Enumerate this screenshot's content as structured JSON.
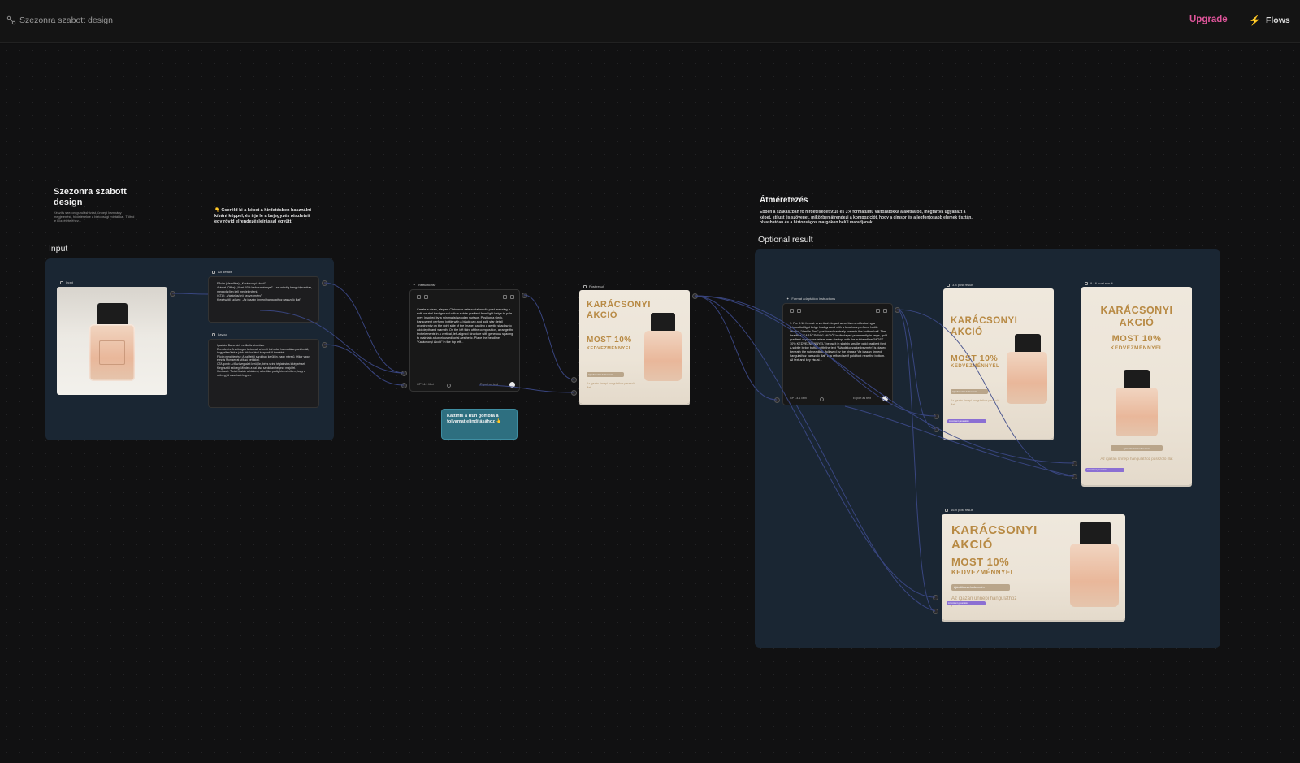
{
  "topbar": {
    "flow_name": "Szezonra szabott design",
    "upgrade_label": "Upgrade",
    "flows_label": "Flows",
    "icons": [
      "flow-icon",
      "bolt-icon"
    ],
    "upgrade_color": "#e0559b"
  },
  "canvas": {
    "title": "Szezonra szabott design",
    "title_desc": "Készíts szezon-guruláshívást, ünnepi kampány megjelenést, hirdetésekre a biztonsági mintákkal. Töltsd le közzétételéhez...",
    "note_left": "👇 Cseréld ki a képet a hirdetésben használni kívánt képpel, és írja le a bejegyzés részleteit egy rövid elrendezésleírással együtt.",
    "input_group_title": "Input",
    "optional_group_title": "Optional result",
    "resize_title": "Átméretezés",
    "resize_desc": "Ebben a szakaszban fő hirdetésedet 9:16 és 3:4 formátumú változatokká alakíthatod, megtartva ugyanazt a képet, stílust és szöveget, miközben átrendezi a kompozíciót, hogy a címsor és a legfontosabb elemek tisztán, olvashatóan és a biztonságos margókon belül maradjanak.",
    "tooltip": "Kattints a Run gombra a folyamat elindításához 👆"
  },
  "nodes": {
    "input_label": "Input",
    "ad_details_label": "Ad details",
    "ad_details_items": [
      "Főcím (Headline): „Karácsonyi Akció!”",
      "Ajánlat (Offer): „Most 10% kedvezménnyel” – azt mindig hangsúlyozottan, meggyőzően kell megjeleníteni.",
      "(CTA): „Vásárlás(on) kedvezmény”",
      "Kiegészítő szöveg: „Az igazán ünnepi hangulathoz passzoló illat”"
    ],
    "layout_label": "Layout",
    "layout_items": [
      "Igazítás: Balra zárt, vertikális struktúra.",
      "Elrendezés: A szövegek tartoznak a kereti bal oldali harmadába pozicionált, hogy elkerüljék a jobb oldalon lévő központi fő termékét.",
      "Főcím megjelenése: A bal felső sarokban kerüljön, nagy méretű, félkör vagy erezős Montserrat stílusú betűkkel.",
      "CTA gomb: A főszöveg alatt kerüljön, bézs színű téglatestes kiképzéssel.",
      "Kiegészítő szöveg: Minden a bal alsó sarokban helyezz majd fel.",
      "Kontraszt: Tartsd tisztán a hátteret, a betűket pedig kis méretben, hogy a szöveg jól olvasható legyen."
    ],
    "instructions_label": "Instructions",
    "instructions_text": "Create a clean, elegant Christmas sale social media post featuring a soft, neutral background with a subtle gradient from light beige to pale grey, inspired by a minimalist wooden surface. Position a sleek, transparent perfume bottle with a black cap and gold star detail prominently on the right side of the image, casting a gentle shadow to add depth and warmth. On the left third of the composition, arrange the text elements in a vertical, left-aligned structure with generous spacing to maintain a luxurious editorial aesthetic. Place the headline “Karácsonyi Akció” in the top left...",
    "model_label": "GPT-4.1 Mini",
    "export_label": "Export as text",
    "post_result_label": "Post result",
    "format_label": "Format adaptation instructions",
    "format_text": "1. For 9:16 format: A vertical elegant advertisement featuring a minimalist light beige background with a luxurious perfume bottle labeled “Vanilla Sins” positioned centrally towards the bottom half. The headline “KARÁCSONYI AKCIÓ” is displayed prominently in large, gold gradient uppercase letters near the top, with the subheadline “MOST 10% KEDVEZMÉNNYEL” below it in slightly smaller gold gradient font. A subtle beige button with the text “Ajándékozza kedvezmén” is placed beneath the subheadline, followed by the phrase “Az igazán ünnepi hangulathoz passzoló illat” in a refined serif gold font near the bottom. All text and key visual...",
    "result_34_label": "3-4 post result",
    "result_916_label": "9-16 post result",
    "result_169_label": "16-9 post result"
  },
  "poster": {
    "headline_1": "KARÁCSONYI",
    "headline_2": "AKCIÓ",
    "offer_1": "MOST 10%",
    "offer_2": "KEDVEZMÉNNYEL",
    "cta": "Ajándékozza kedvezmén",
    "tagline": "Az igazán ünnepi hangulathoz passzoló illat",
    "label_text": "Vanilla Sins",
    "badge_text": "AI content generation",
    "colors": {
      "gold": "#b88a44",
      "poster_bg": "#efe8dd",
      "group_bg": "#1a2633",
      "tooltip_bg": "#2e6f80"
    }
  }
}
